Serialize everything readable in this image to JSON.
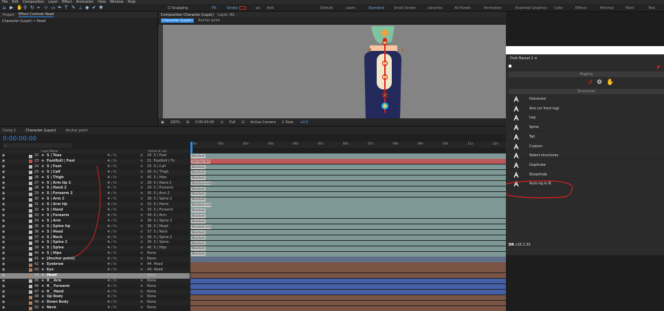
{
  "menu": [
    "File",
    "Edit",
    "Composition",
    "Layer",
    "Effect",
    "Animation",
    "View",
    "Window",
    "Help"
  ],
  "toolbar": {
    "snapping": "Snapping",
    "fill": "Fill",
    "stroke": "Stroke",
    "px": "- px",
    "add": "Add:"
  },
  "workspaces": [
    "Default",
    "Learn",
    "Standard",
    "Small Screen",
    "Libraries",
    "All Panels",
    "Animation",
    "Essential Graphics",
    "Color",
    "Effects",
    "Minimal",
    "Paint",
    "Text"
  ],
  "project": {
    "tab": "Project",
    "effect_tab": "Effect Controls Head",
    "layer_path": "Character (Layer) • Head"
  },
  "comp": {
    "tab": "Composition Character (Layer)",
    "layer_tab": "Layer: BG",
    "sub_tab": "Character (Layer)",
    "anchor": "Anchor point",
    "ruler": [
      "100",
      "150",
      "200",
      "250",
      "300",
      "350",
      "400",
      "450",
      "500",
      "550",
      "600",
      "650",
      "700",
      "750",
      "800",
      "850",
      "900",
      "950",
      "1000",
      "1050",
      "1100",
      "1150",
      "1200",
      "1250",
      "1300",
      "1350",
      "1400"
    ],
    "zoom": "200%",
    "time": "0:00:00:00",
    "quality": "Full",
    "camera": "Active Camera",
    "view": "1 View",
    "exposure": "+0.0"
  },
  "timeline": {
    "tabs": [
      "Comp 1",
      "Character (Layer)",
      "Anchor point"
    ],
    "timecode": "0:00:00:00",
    "search_placeholder": "ρₕ",
    "col_layer": "Layer Name",
    "col_parent": "Parent & Link",
    "ticks": [
      "0s",
      "01s",
      "02s",
      "03s",
      "04s",
      "05s",
      "06s",
      "07s",
      "08s",
      "09s",
      "10s",
      "11s",
      "12s"
    ]
  },
  "layers": [
    {
      "num": "22",
      "name": "S | Toes",
      "parent": "24. S | Foot",
      "track": "teal",
      "label": "Structure"
    },
    {
      "num": "23",
      "name": "FootRoll | Foot",
      "parent": "21. FootRoll | Fo",
      "track": "red",
      "label": "Ctrl-Foot Roll"
    },
    {
      "num": "24",
      "name": "S | Foot",
      "parent": "25. S | Calf",
      "track": "teal",
      "label": "Structure"
    },
    {
      "num": "25",
      "name": "S | Calf",
      "parent": "26. S | Thigh",
      "track": "teal",
      "label": "Structure"
    },
    {
      "num": "26",
      "name": "S | Thigh",
      "parent": "40. S | Hips",
      "track": "teal",
      "label": "Structure"
    },
    {
      "num": "27",
      "name": "S | Arm tip 2",
      "parent": "28. S | Hand 2",
      "track": "teal",
      "label": "Structure end"
    },
    {
      "num": "28",
      "name": "S | Hand 2",
      "parent": "29. S | Forearm",
      "track": "teal",
      "label": "Structure"
    },
    {
      "num": "29",
      "name": "S | Forearm 2",
      "parent": "30. S | Arm 2",
      "track": "teal",
      "label": "Structure"
    },
    {
      "num": "30",
      "name": "S | Arm 2",
      "parent": "38. S | Spine 2",
      "track": "teal",
      "label": "Structure"
    },
    {
      "num": "31",
      "name": "S | Arm tip",
      "parent": "32. S | Hand",
      "track": "teal",
      "label": "Structure end"
    },
    {
      "num": "32",
      "name": "S | Hand",
      "parent": "33. S | Forearm",
      "track": "teal",
      "label": "Structure"
    },
    {
      "num": "33",
      "name": "S | Forearm",
      "parent": "34. S | Arm",
      "track": "teal",
      "label": "Structure"
    },
    {
      "num": "34",
      "name": "S | Arm",
      "parent": "38. S | Spine 2",
      "track": "teal",
      "label": "Structure"
    },
    {
      "num": "35",
      "name": "S | Spine tip",
      "parent": "36. S | Head",
      "track": "teal",
      "label": "Structure end"
    },
    {
      "num": "36",
      "name": "S | Head",
      "parent": "37. S | Neck",
      "track": "teal",
      "label": "Structure"
    },
    {
      "num": "37",
      "name": "S | Neck",
      "parent": "38. S | Spine 2",
      "track": "teal",
      "label": "Structure"
    },
    {
      "num": "38",
      "name": "S | Spine 2",
      "parent": "39. S | Spine",
      "track": "teal",
      "label": "Structure"
    },
    {
      "num": "39",
      "name": "S | Spine",
      "parent": "40. S | Hips",
      "track": "teal",
      "label": "Structure"
    },
    {
      "num": "40",
      "name": "S | Hips",
      "parent": "None",
      "track": "teal",
      "label": "Structure"
    },
    {
      "num": "41",
      "name": "[Anchor point]",
      "parent": "None",
      "track": "slate",
      "label": ""
    },
    {
      "num": "42",
      "name": "Eyebrow",
      "parent": "44. Head",
      "track": "brown",
      "label": ""
    },
    {
      "num": "43",
      "name": "Eye",
      "parent": "44. Head",
      "track": "brown",
      "label": ""
    },
    {
      "num": "44",
      "name": "Head",
      "parent": "None",
      "track": "brown",
      "label": ""
    },
    {
      "num": "45",
      "name": "R _ Arm",
      "parent": "None",
      "track": "blue",
      "label": ""
    },
    {
      "num": "46",
      "name": "R _ Forearm",
      "parent": "None",
      "track": "blue",
      "label": ""
    },
    {
      "num": "47",
      "name": "R _ Hand",
      "parent": "None",
      "track": "blue",
      "label": ""
    },
    {
      "num": "48",
      "name": "Up Body",
      "parent": "None",
      "track": "brown",
      "label": ""
    },
    {
      "num": "49",
      "name": "Down Body",
      "parent": "None",
      "track": "brown",
      "label": ""
    },
    {
      "num": "50",
      "name": "Neck",
      "parent": "None",
      "track": "brown",
      "label": ""
    }
  ],
  "duik": {
    "title": "Duik Bassel.2",
    "section_rigging": "Rigging",
    "section_structures": "Structures",
    "version": "v16.2.30",
    "items": [
      {
        "label": "Hominoid",
        "icon": "hominoid-icon"
      },
      {
        "label": "Arm (or front leg)",
        "icon": "arm-icon"
      },
      {
        "label": "Leg",
        "icon": "leg-icon"
      },
      {
        "label": "Spine",
        "icon": "spine-icon"
      },
      {
        "label": "Tail",
        "icon": "tail-icon"
      },
      {
        "label": "Custom",
        "icon": "custom-icon"
      },
      {
        "label": "Select structures",
        "icon": "select-structures-icon"
      },
      {
        "label": "Duplicate",
        "icon": "duplicate-icon"
      },
      {
        "label": "Show/hide",
        "icon": "show-hide-icon"
      },
      {
        "label": "Auto-rig & IK",
        "icon": "auto-rig-icon"
      }
    ]
  },
  "colors": {
    "accent": "#2d8ceb",
    "teal": "#7e9995",
    "red": "#c0575a",
    "slate": "#5f6f88",
    "brown": "#7a5546",
    "blue": "#4660a8",
    "viewer_bg": "#848484",
    "annot": "#e0201e",
    "selected_row": "#8b8b8b"
  }
}
